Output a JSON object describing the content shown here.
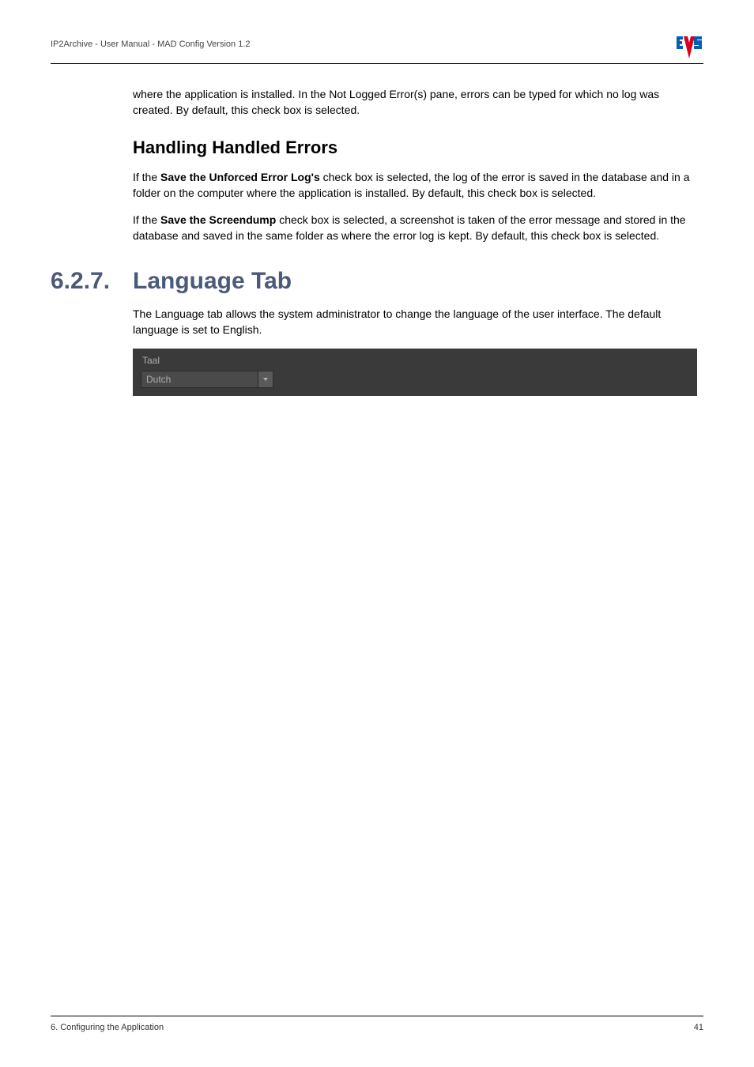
{
  "header": {
    "breadcrumb": "IP2Archive - User Manual - MAD Config Version 1.2"
  },
  "intro_para": "where the application is installed. In the Not Logged Error(s) pane, errors can be typed for which no log was created. By default, this check box is selected.",
  "h2_handling": "Handling Handled Errors",
  "para_unforced_pre": "If the ",
  "para_unforced_bold": "Save the Unforced Error Log's",
  "para_unforced_post": " check box is selected, the log of the error is saved in the database and in a folder on the computer where the application is installed. By default, this check box is selected.",
  "para_screendump_pre": "If the ",
  "para_screendump_bold": "Save the Screendump",
  "para_screendump_post": " check box is selected, a screenshot is taken of the error message and stored in the database and saved in the same folder as where the error log is kept. By default, this check box is selected.",
  "section": {
    "num": "6.2.7.",
    "title": "Language Tab"
  },
  "para_lang": "The Language tab allows the system administrator to change the language of the user interface. The default language is set to English.",
  "ui": {
    "group_label": "Taal",
    "combo_value": "Dutch"
  },
  "footer": {
    "left": "6. Configuring the Application",
    "right": "41"
  }
}
